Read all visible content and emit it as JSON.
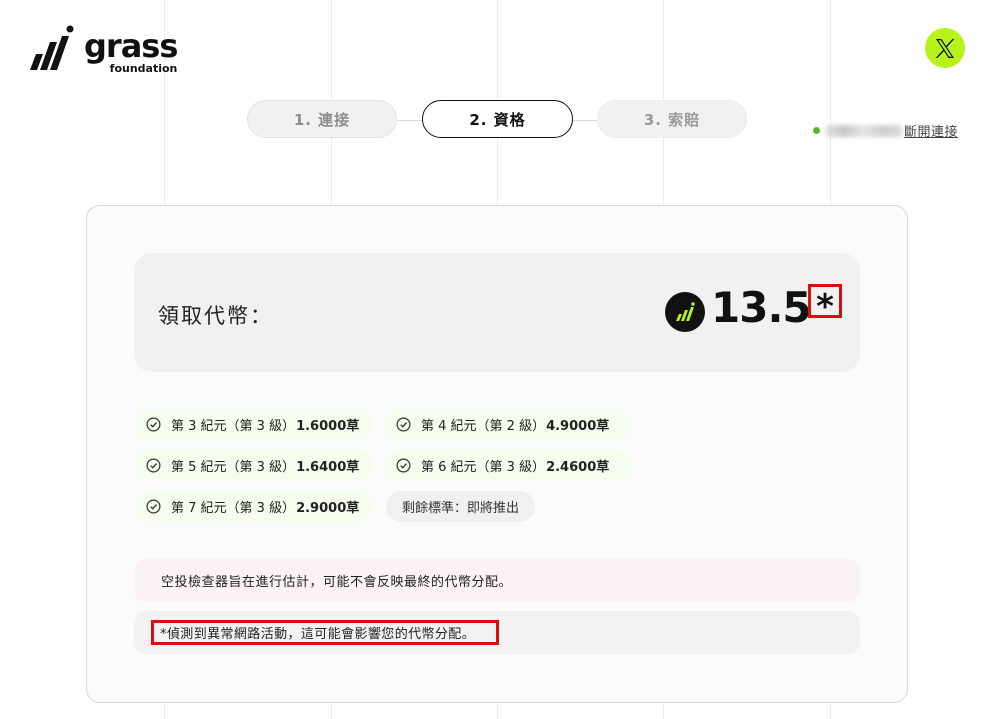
{
  "brand": {
    "name": "grass",
    "subtitle": "foundation"
  },
  "social": {
    "icon": "x-icon",
    "label": "𝕏",
    "accent": "#b7f31a"
  },
  "steps": [
    {
      "label": "1. 連接",
      "state": "done"
    },
    {
      "label": "2. 資格",
      "state": "active"
    },
    {
      "label": "3. 索賠",
      "state": "pending"
    }
  ],
  "wallet": {
    "status_color": "#5cb531",
    "disconnect_label": "斷開連接"
  },
  "reward": {
    "label": "領取代幣：",
    "value": "13.5",
    "asterisk": "*",
    "token_icon": "grass-token-icon"
  },
  "epochs": [
    {
      "text": "第 3 紀元（第 3 級）",
      "amount": "1.6000草",
      "status": "check"
    },
    {
      "text": "第 4 紀元（第 2 級）",
      "amount": "4.9000草",
      "status": "check"
    },
    {
      "text": "第 5 紀元（第 3 級）",
      "amount": "1.6400草",
      "status": "check"
    },
    {
      "text": "第 6 紀元（第 3 級）",
      "amount": "2.4600草",
      "status": "check"
    },
    {
      "text": "第 7 紀元（第 3 級）",
      "amount": "2.9000草",
      "status": "check"
    }
  ],
  "remaining": "剩餘標準：即將推出",
  "notes": {
    "estimate": "空投檢查器旨在進行估計，可能不會反映最終的代幣分配。",
    "warning": "*偵測到異常網路活動，這可能會影響您的代幣分配。"
  },
  "colors": {
    "highlight": "#d90f0f",
    "check_bg": "#f4fdee"
  }
}
